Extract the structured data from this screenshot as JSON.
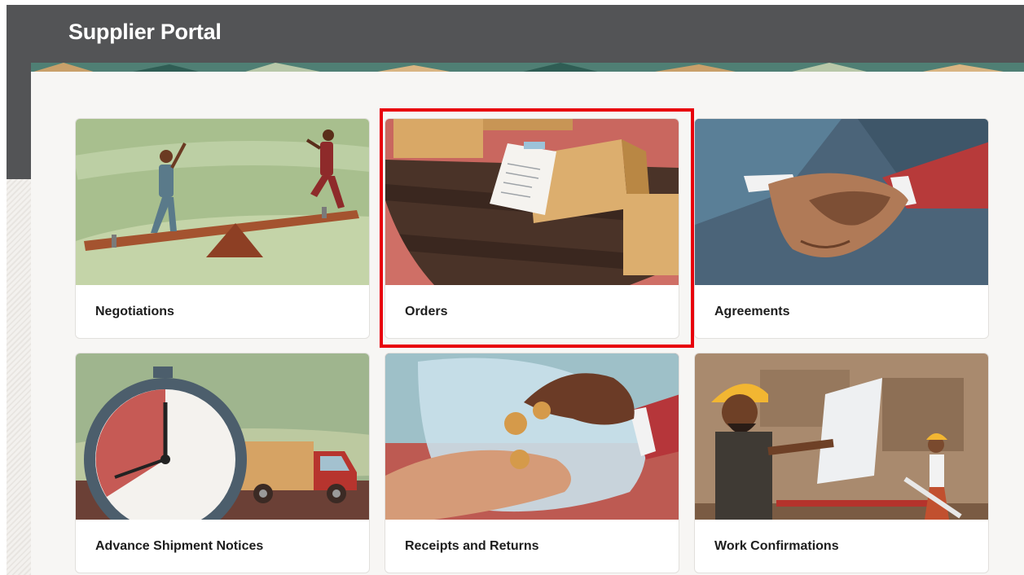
{
  "header": {
    "title": "Supplier Portal",
    "background": "#535456"
  },
  "cards": [
    {
      "label": "Negotiations",
      "illustration": "seesaw-negotiation-illustration"
    },
    {
      "label": "Orders",
      "illustration": "boxes-conveyor-illustration"
    },
    {
      "label": "Agreements",
      "illustration": "handshake-illustration"
    },
    {
      "label": "Advance Shipment Notices",
      "illustration": "stopwatch-truck-illustration"
    },
    {
      "label": "Receipts and Returns",
      "illustration": "coin-exchange-illustration"
    },
    {
      "label": "Work Confirmations",
      "illustration": "construction-workers-illustration"
    }
  ],
  "highlight": {
    "target": "Orders",
    "color": "#e8000b"
  }
}
